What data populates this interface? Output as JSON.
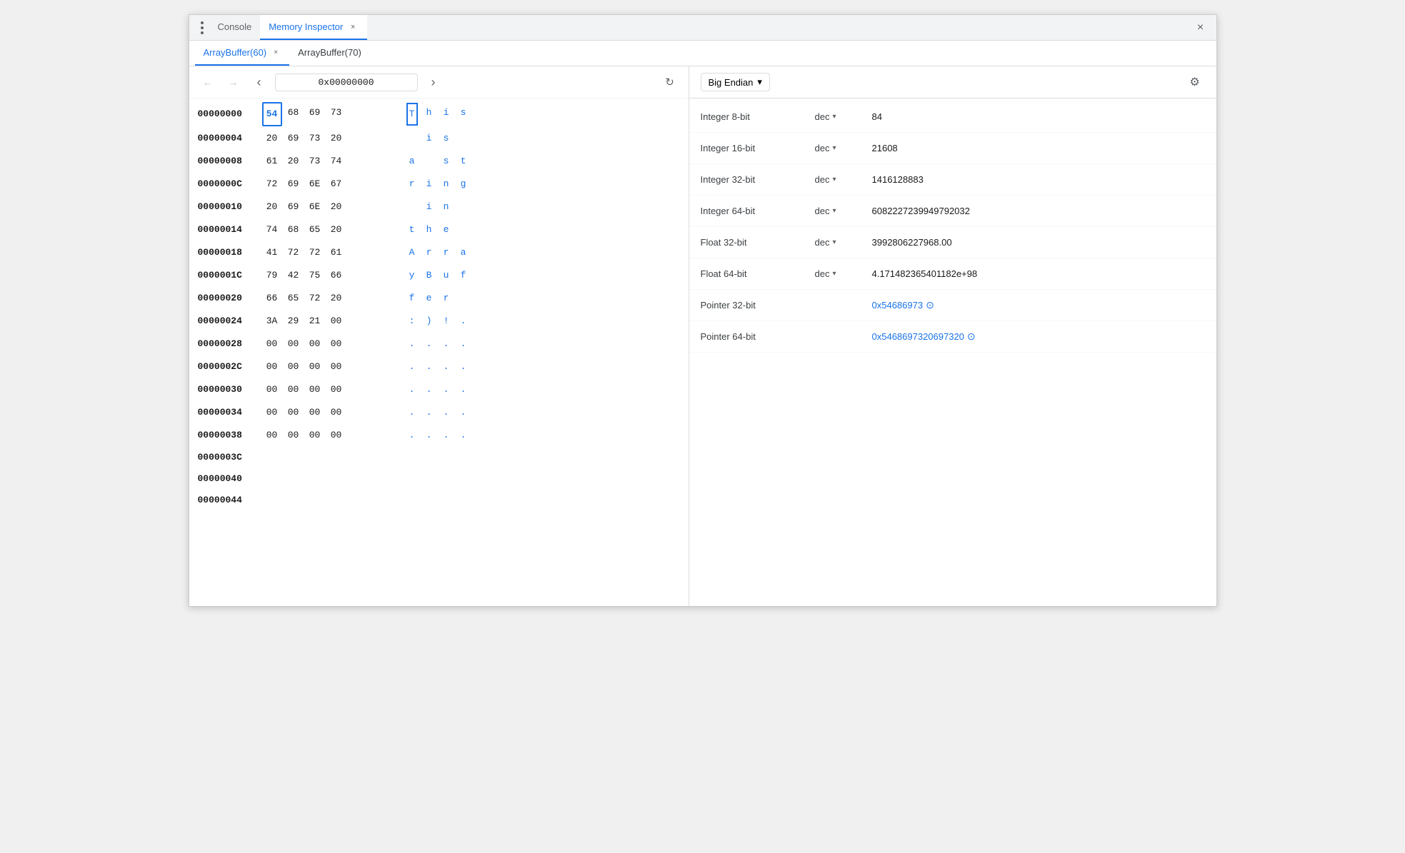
{
  "window": {
    "title": "Memory Inspector"
  },
  "top_bar": {
    "console_tab": "Console",
    "memory_inspector_tab": "Memory Inspector",
    "close_label": "×"
  },
  "buffer_tabs": [
    {
      "label": "ArrayBuffer(60)",
      "active": true
    },
    {
      "label": "ArrayBuffer(70)",
      "active": false
    }
  ],
  "nav": {
    "address": "0x00000000",
    "back_title": "back",
    "forward_title": "forward",
    "prev_title": "previous",
    "next_title": "next",
    "refresh_title": "refresh"
  },
  "memory_rows": [
    {
      "addr": "00000000",
      "bytes": [
        "54",
        "68",
        "69",
        "73"
      ],
      "chars": [
        "T",
        "h",
        "i",
        "s"
      ],
      "highlight_byte": 0,
      "highlight_char": 0
    },
    {
      "addr": "00000004",
      "bytes": [
        "20",
        "69",
        "73",
        "20"
      ],
      "chars": [
        " ",
        "i",
        "s",
        " "
      ],
      "highlight_byte": -1,
      "highlight_char": -1
    },
    {
      "addr": "00000008",
      "bytes": [
        "61",
        "20",
        "73",
        "74"
      ],
      "chars": [
        "a",
        " ",
        "s",
        "t"
      ],
      "highlight_byte": -1,
      "highlight_char": -1
    },
    {
      "addr": "0000000C",
      "bytes": [
        "72",
        "69",
        "6E",
        "67"
      ],
      "chars": [
        "r",
        "i",
        "n",
        "g"
      ],
      "highlight_byte": -1,
      "highlight_char": -1
    },
    {
      "addr": "00000010",
      "bytes": [
        "20",
        "69",
        "6E",
        "20"
      ],
      "chars": [
        " ",
        "i",
        "n",
        " "
      ],
      "highlight_byte": -1,
      "highlight_char": -1
    },
    {
      "addr": "00000014",
      "bytes": [
        "74",
        "68",
        "65",
        "20"
      ],
      "chars": [
        "t",
        "h",
        "e",
        " "
      ],
      "highlight_byte": -1,
      "highlight_char": -1
    },
    {
      "addr": "00000018",
      "bytes": [
        "41",
        "72",
        "72",
        "61"
      ],
      "chars": [
        "A",
        "r",
        "r",
        "a"
      ],
      "highlight_byte": -1,
      "highlight_char": -1
    },
    {
      "addr": "0000001C",
      "bytes": [
        "79",
        "42",
        "75",
        "66"
      ],
      "chars": [
        "y",
        "B",
        "u",
        "f"
      ],
      "highlight_byte": -1,
      "highlight_char": -1
    },
    {
      "addr": "00000020",
      "bytes": [
        "66",
        "65",
        "72",
        "20"
      ],
      "chars": [
        "f",
        "e",
        "r",
        " "
      ],
      "highlight_byte": -1,
      "highlight_char": -1
    },
    {
      "addr": "00000024",
      "bytes": [
        "3A",
        "29",
        "21",
        "00"
      ],
      "chars": [
        ":",
        ")",
        "!",
        "."
      ],
      "highlight_byte": -1,
      "highlight_char": -1
    },
    {
      "addr": "00000028",
      "bytes": [
        "00",
        "00",
        "00",
        "00"
      ],
      "chars": [
        ".",
        ".",
        ".",
        "."
      ],
      "highlight_byte": -1,
      "highlight_char": -1
    },
    {
      "addr": "0000002C",
      "bytes": [
        "00",
        "00",
        "00",
        "00"
      ],
      "chars": [
        ".",
        ".",
        ".",
        "."
      ],
      "highlight_byte": -1,
      "highlight_char": -1
    },
    {
      "addr": "00000030",
      "bytes": [
        "00",
        "00",
        "00",
        "00"
      ],
      "chars": [
        ".",
        ".",
        ".",
        "."
      ],
      "highlight_byte": -1,
      "highlight_char": -1
    },
    {
      "addr": "00000034",
      "bytes": [
        "00",
        "00",
        "00",
        "00"
      ],
      "chars": [
        ".",
        ".",
        ".",
        "."
      ],
      "highlight_byte": -1,
      "highlight_char": -1
    },
    {
      "addr": "00000038",
      "bytes": [
        "00",
        "00",
        "00",
        "00"
      ],
      "chars": [
        ".",
        ".",
        ".",
        "."
      ],
      "highlight_byte": -1,
      "highlight_char": -1
    },
    {
      "addr": "0000003C",
      "bytes": [],
      "chars": [],
      "highlight_byte": -1,
      "highlight_char": -1
    },
    {
      "addr": "00000040",
      "bytes": [],
      "chars": [],
      "highlight_byte": -1,
      "highlight_char": -1
    },
    {
      "addr": "00000044",
      "bytes": [],
      "chars": [],
      "highlight_byte": -1,
      "highlight_char": -1
    }
  ],
  "right_panel": {
    "endian_label": "Big Endian",
    "settings_title": "settings",
    "values": [
      {
        "label": "Integer 8-bit",
        "format": "dec",
        "value": "84",
        "is_pointer": false
      },
      {
        "label": "Integer 16-bit",
        "format": "dec",
        "value": "21608",
        "is_pointer": false
      },
      {
        "label": "Integer 32-bit",
        "format": "dec",
        "value": "1416128883",
        "is_pointer": false
      },
      {
        "label": "Integer 64-bit",
        "format": "dec",
        "value": "6082227239949792032",
        "is_pointer": false
      },
      {
        "label": "Float 32-bit",
        "format": "dec",
        "value": "3992806227968.00",
        "is_pointer": false
      },
      {
        "label": "Float 64-bit",
        "format": "dec",
        "value": "4.171482365401182e+98",
        "is_pointer": false
      },
      {
        "label": "Pointer 32-bit",
        "format": "",
        "value": "0x54686973",
        "is_pointer": true
      },
      {
        "label": "Pointer 64-bit",
        "format": "",
        "value": "0x5468697320697320",
        "is_pointer": true
      }
    ]
  },
  "icons": {
    "dots": "⋮",
    "close": "×",
    "back": "←",
    "forward": "→",
    "chevron_left": "‹",
    "chevron_right": "›",
    "refresh": "↻",
    "settings": "⚙",
    "chevron_down": "▾",
    "pointer_arrow": "⊙"
  }
}
